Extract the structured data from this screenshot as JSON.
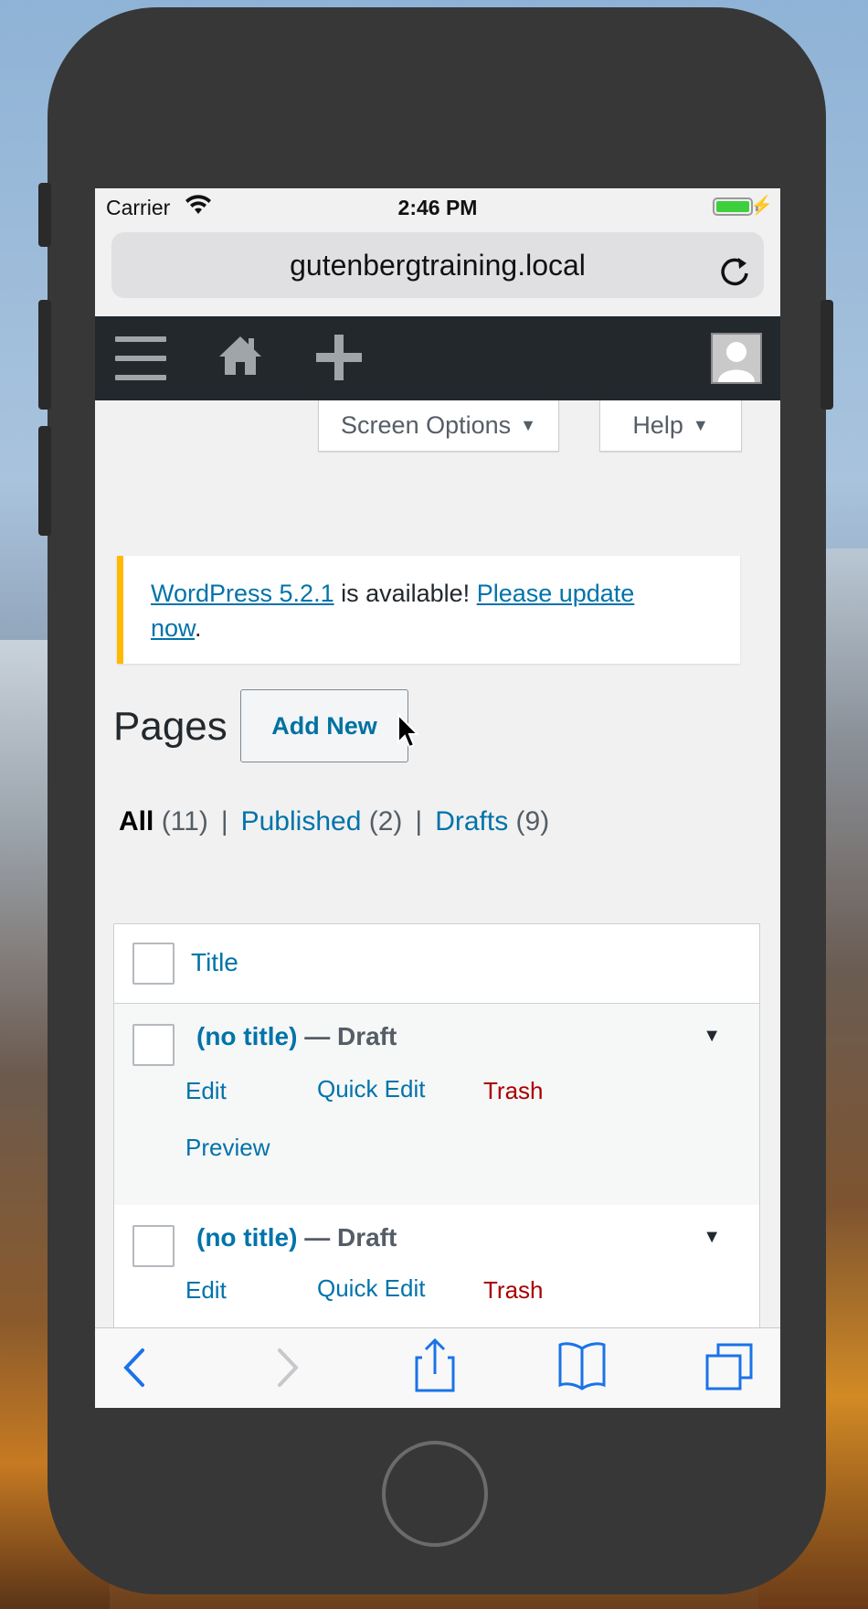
{
  "status_bar": {
    "carrier": "Carrier",
    "time": "2:46 PM"
  },
  "url_bar": {
    "url": "gutenbergtraining.local"
  },
  "admin_bar": {
    "icons": [
      "menu-icon",
      "home-icon",
      "plus-icon",
      "avatar"
    ]
  },
  "screen_meta": {
    "screen_options_label": "Screen Options",
    "help_label": "Help"
  },
  "notice": {
    "version_link": "WordPress 5.2.1",
    "middle_text": " is available! ",
    "update_link_part1": "Please update",
    "update_link_part2": "now",
    "end_text": ".",
    "border_color": "#ffb900"
  },
  "page": {
    "title": "Pages",
    "add_new_label": "Add New"
  },
  "filters": [
    {
      "label": "All",
      "count": "(11)",
      "current": true
    },
    {
      "label": "Published",
      "count": "(2)",
      "current": false
    },
    {
      "label": "Drafts",
      "count": "(9)",
      "current": false
    }
  ],
  "filter_separator": "|",
  "table": {
    "header_title": "Title",
    "rows": [
      {
        "title": "(no title)",
        "state": " — Draft",
        "actions": {
          "edit": "Edit",
          "quick_edit": "Quick Edit",
          "trash": "Trash",
          "preview": "Preview"
        }
      },
      {
        "title": "(no title)",
        "state": " — Draft",
        "actions": {
          "edit": "Edit",
          "quick_edit": "Quick Edit",
          "trash": "Trash"
        }
      }
    ]
  },
  "toolbar": {
    "icons": [
      "back-icon",
      "forward-icon",
      "share-icon",
      "bookmarks-icon",
      "tabs-icon"
    ]
  },
  "colors": {
    "link": "#0073aa",
    "trash": "#a00",
    "admin_bar": "#23282d"
  }
}
